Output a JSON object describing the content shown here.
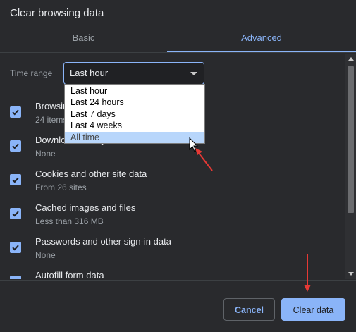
{
  "dialog": {
    "title": "Clear browsing data"
  },
  "tabs": [
    {
      "label": "Basic"
    },
    {
      "label": "Advanced"
    }
  ],
  "time_range": {
    "label": "Time range",
    "selected": "Last hour",
    "options": [
      "Last hour",
      "Last 24 hours",
      "Last 7 days",
      "Last 4 weeks",
      "All time"
    ],
    "highlighted": "All time"
  },
  "items": [
    {
      "title": "Browsing history",
      "subtitle": "24 items",
      "checked": true
    },
    {
      "title": "Download history",
      "subtitle": "None",
      "checked": true
    },
    {
      "title": "Cookies and other site data",
      "subtitle": "From 26 sites",
      "checked": true
    },
    {
      "title": "Cached images and files",
      "subtitle": "Less than 316 MB",
      "checked": true
    },
    {
      "title": "Passwords and other sign-in data",
      "subtitle": "None",
      "checked": true
    },
    {
      "title": "Autofill form data",
      "subtitle": "",
      "checked": true
    }
  ],
  "buttons": {
    "cancel": "Cancel",
    "clear": "Clear data"
  },
  "colors": {
    "accent": "#8ab4f8",
    "background": "#292a2d",
    "annotation": "#e53935"
  }
}
